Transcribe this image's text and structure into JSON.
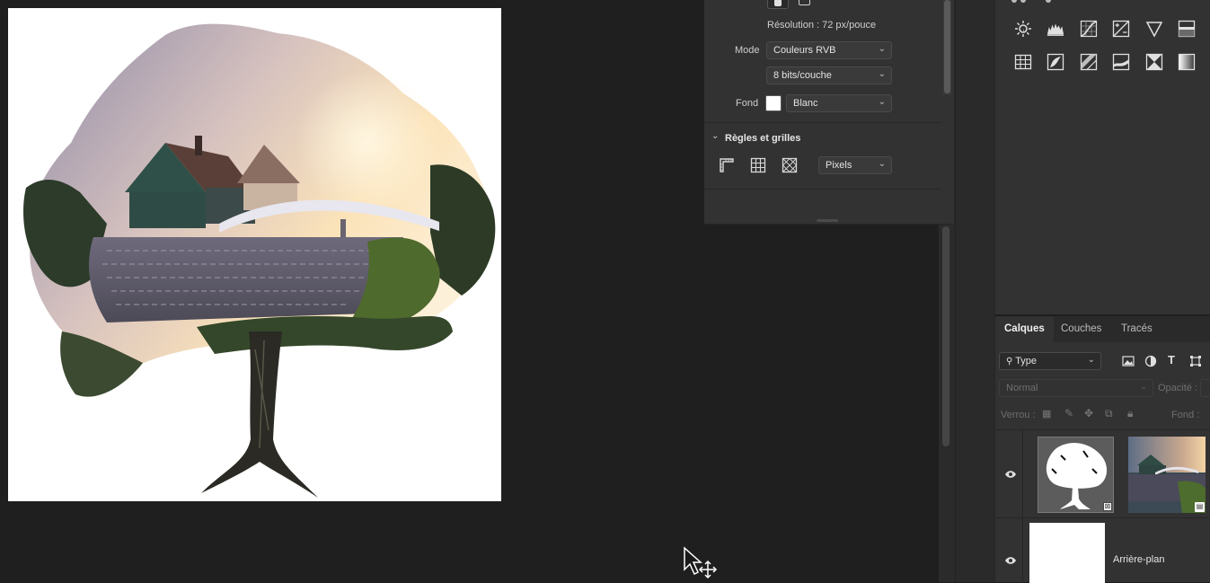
{
  "properties": {
    "resolution": "Résolution : 72 px/pouce",
    "mode_label": "Mode",
    "mode_value": "Couleurs RVB",
    "depth_value": "8 bits/couche",
    "fond_label": "Fond",
    "fond_value": "Blanc",
    "section_rules": "Règles et grilles",
    "units_value": "Pixels"
  },
  "layers": {
    "tabs": [
      "Calques",
      "Couches",
      "Tracés"
    ],
    "filter_value": "Type",
    "blend_mode": "Normal",
    "opacity_label": "Opacité :",
    "lock_label": "Verrou :",
    "fill_label": "Fond :",
    "background_layer_name": "Arrière-plan"
  },
  "icons": {
    "adjustments_row1": [
      "brightness-icon",
      "levels-icon",
      "curves-icon",
      "exposure-icon",
      "vibrance-icon",
      "hue-saturation-icon"
    ],
    "adjustments_row2": [
      "color-lookup-icon",
      "invert-icon",
      "posterize-icon",
      "threshold-icon",
      "selective-color-icon",
      "gradient-map-icon"
    ]
  },
  "colors": {
    "panel_bg": "#323232",
    "workspace_bg": "#1f1f1f",
    "canvas_bg": "#ffffff"
  }
}
